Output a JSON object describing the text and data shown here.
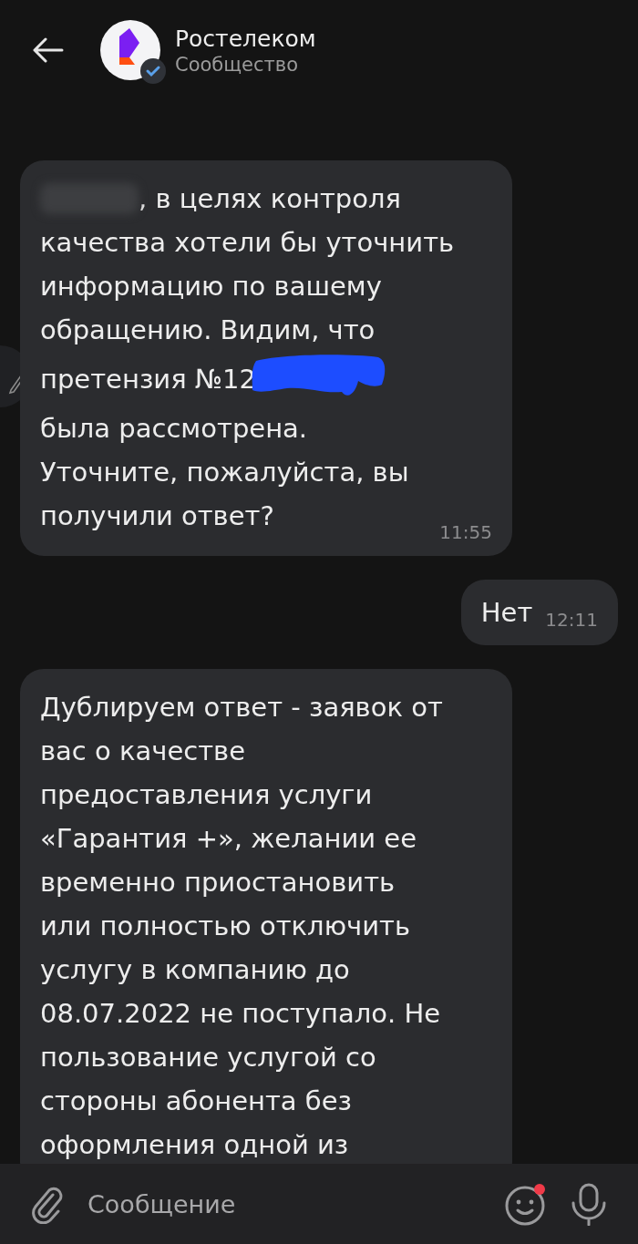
{
  "header": {
    "title": "Ростелеком",
    "subtitle": "Сообщество",
    "verified": true
  },
  "messages": [
    {
      "kind": "incoming",
      "lines": [
        {
          "text": ", в целях контроля",
          "blurred": true
        },
        {
          "text": "качества хотели бы уточнить"
        },
        {
          "text": "информацию по вашему"
        },
        {
          "text": "обращению. Видим, что"
        },
        {
          "text": "претензия №12",
          "scribbled": true
        },
        {
          "text": "была рассмотрена."
        },
        {
          "text": "Уточните, пожалуйста, вы"
        },
        {
          "text": "получили ответ?"
        }
      ],
      "time": "11:55"
    },
    {
      "kind": "outgoing",
      "lines": [
        {
          "text": "Нет"
        }
      ],
      "time": "12:11"
    },
    {
      "kind": "incoming",
      "lines": [
        {
          "text": "Дублируем ответ - заявок от"
        },
        {
          "text": "вас о качестве"
        },
        {
          "text": "предоставления услуги"
        },
        {
          "text": "«Гарантия +», желании ее"
        },
        {
          "text": "временно приостановить"
        },
        {
          "text": "или полностью отключить"
        },
        {
          "text": "услугу в компанию до"
        },
        {
          "text": "08.07.2022 не поступало. Не"
        },
        {
          "text": "пользование услугой со"
        },
        {
          "text": "стороны абонента без"
        },
        {
          "text": "оформления одной из"
        }
      ]
    }
  ],
  "composer": {
    "placeholder": "Сообщение",
    "emoji_badge": true
  }
}
